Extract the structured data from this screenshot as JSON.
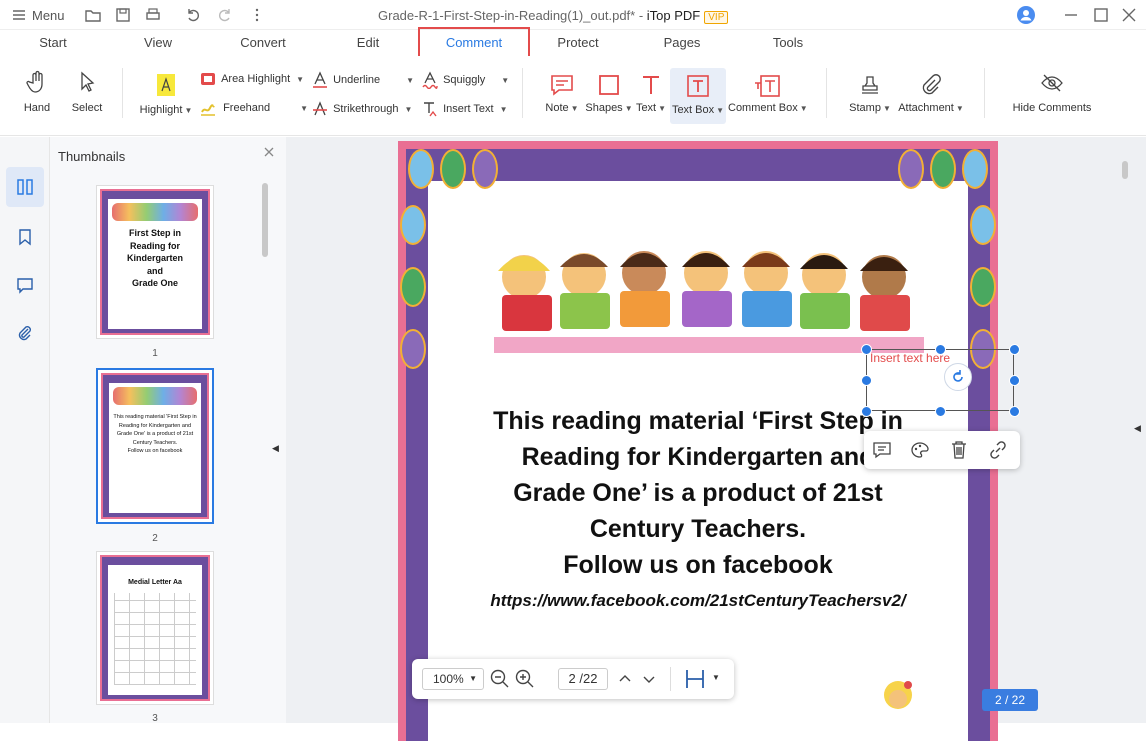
{
  "titlebar": {
    "menu_label": "Menu",
    "doc_title": "Grade-R-1-First-Step-in-Reading(1)_out.pdf* - ",
    "app_name": "iTop PDF",
    "vip_badge": "VIP"
  },
  "tabs": [
    "Start",
    "View",
    "Convert",
    "Edit",
    "Comment",
    "Protect",
    "Pages",
    "Tools"
  ],
  "active_tab": "Comment",
  "ribbon": {
    "hand": "Hand",
    "select": "Select",
    "highlight": "Highlight",
    "area_highlight": "Area Highlight",
    "freehand": "Freehand",
    "underline": "Underline",
    "strikethrough": "Strikethrough",
    "squiggly": "Squiggly",
    "insert_text": "Insert Text",
    "note": "Note",
    "shapes": "Shapes",
    "text": "Text",
    "text_box": "Text Box",
    "comment_box": "Comment Box",
    "stamp": "Stamp",
    "attachment": "Attachment",
    "hide_comments": "Hide Comments"
  },
  "thumbnails": {
    "title": "Thumbnails",
    "pages": [
      {
        "num": "1",
        "lines": [
          "First Step in",
          "Reading for",
          "Kindergarten",
          "and",
          "Grade One"
        ]
      },
      {
        "num": "2",
        "lines": [
          "This reading material 'First Step in",
          "Reading for Kindergarten and",
          "Grade One' is a product of 21st",
          "Century Teachers.",
          "Follow us on facebook"
        ]
      },
      {
        "num": "3",
        "title": "Medial Letter Aa"
      }
    ]
  },
  "page": {
    "textbox_placeholder": "Insert text here",
    "lines": [
      "This reading material ‘First Step in",
      "Reading for Kindergarten and",
      "Grade One’ is a product of 21st",
      "Century Teachers.",
      "Follow us on facebook"
    ],
    "url": "https://www.facebook.com/21stCenturyTeachersv2/"
  },
  "zoombar": {
    "zoom": "100%",
    "current_page": "2",
    "total_pages": "/22"
  },
  "page_badge": "2 / 22",
  "colors": {
    "accent": "#2a7ae2",
    "highlight_red": "#e34b4b",
    "page_border_pink": "#e96f93",
    "page_border_purple": "#6b4e9e"
  }
}
